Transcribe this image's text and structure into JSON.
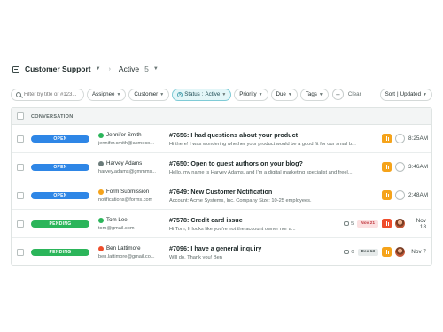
{
  "header": {
    "inbox_name": "Customer Support",
    "view_name": "Active",
    "view_count": "5"
  },
  "filters": {
    "search_placeholder": "Filter by title or #123...",
    "assignee": "Assignee",
    "customer": "Customer",
    "status_label": "Status",
    "status_value": "Active",
    "priority": "Priority",
    "due": "Due",
    "tags": "Tags",
    "clear": "Clear",
    "sort_label": "Sort",
    "sort_value": "Updated"
  },
  "table": {
    "column_header": "CONVERSATION",
    "rows": [
      {
        "status": "OPEN",
        "contact_name": "Jennifer Smith",
        "contact_email": "jennifer.smith@acmeco...",
        "dot_color": "#2bb55a",
        "title": "#7656: I had questions about your product",
        "snippet": "Hi there! I was wondering whether your product would be a good fit for our small b...",
        "comments": "",
        "due": "",
        "channel_color": "#f5a31a",
        "avatar": "empty",
        "time": "8:25AM"
      },
      {
        "status": "OPEN",
        "contact_name": "Harvey Adams",
        "contact_email": "harvey.adams@gmmms...",
        "dot_color": "#6b7b7a",
        "title": "#7650: Open to guest authors on your blog?",
        "snippet": "Hello, my name is Harvey Adams, and I'm a digital marketing specialist and freel...",
        "comments": "",
        "due": "",
        "channel_color": "#f5a31a",
        "avatar": "empty",
        "time": "3:46AM"
      },
      {
        "status": "OPEN",
        "contact_name": "Form Submission",
        "contact_email": "notifications@forms.com",
        "dot_color": "#f5a31a",
        "title": "#7649: New Customer Notification",
        "snippet": "Account: Acme Systems, Inc. Company Size: 10-25 employees.",
        "comments": "",
        "due": "",
        "channel_color": "#f5a31a",
        "avatar": "empty",
        "time": "2:48AM"
      },
      {
        "status": "PENDING",
        "contact_name": "Tom Lee",
        "contact_email": "tom@gmail.com",
        "dot_color": "#2bb55a",
        "title": "#7578: Credit card issue",
        "snippet": "Hi Tom, It looks like you're not the account owner nor a...",
        "comments": "5",
        "due": "Nov 21",
        "due_style": "red",
        "channel_color": "#ef4d2b",
        "avatar": "face",
        "time": "Nov 18"
      },
      {
        "status": "PENDING",
        "contact_name": "Ben Lattimore",
        "contact_email": "ben.lattimore@gmail.co...",
        "dot_color": "#ef4d2b",
        "title": "#7096: I have a general inquiry",
        "snippet": "Will do. Thank you! Ben",
        "comments": "0",
        "due": "Dec 13",
        "due_style": "grey",
        "channel_color": "#f5a31a",
        "avatar": "face",
        "time": "Nov 7"
      }
    ]
  }
}
